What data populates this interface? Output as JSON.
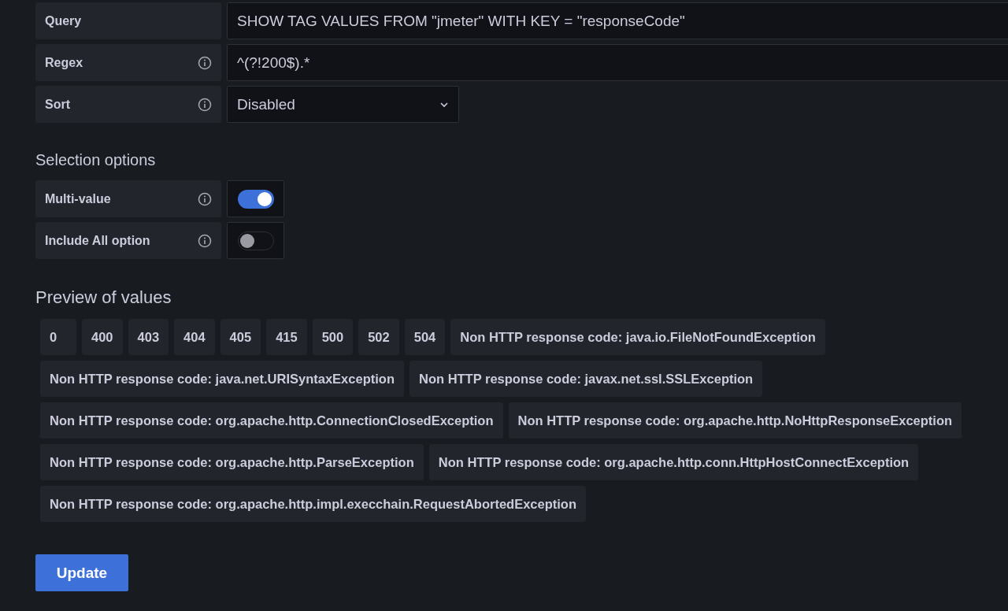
{
  "query_rows": [
    {
      "label": "Query",
      "info": false,
      "kind": "text",
      "value": "SHOW TAG VALUES FROM \"jmeter\" WITH KEY = \"responseCode\""
    },
    {
      "label": "Regex",
      "info": true,
      "kind": "text",
      "value": "^(?!200$).*"
    },
    {
      "label": "Sort",
      "info": true,
      "kind": "select",
      "value": "Disabled"
    }
  ],
  "selection_options": {
    "title": "Selection options",
    "rows": [
      {
        "label": "Multi-value",
        "info": true,
        "on": true
      },
      {
        "label": "Include All option",
        "info": true,
        "on": false
      }
    ]
  },
  "preview": {
    "title": "Preview of values",
    "values": [
      "0",
      "400",
      "403",
      "404",
      "405",
      "415",
      "500",
      "502",
      "504",
      "Non HTTP response code: java.io.FileNotFoundException",
      "Non HTTP response code: java.net.URISyntaxException",
      "Non HTTP response code: javax.net.ssl.SSLException",
      "Non HTTP response code: org.apache.http.ConnectionClosedException",
      "Non HTTP response code: org.apache.http.NoHttpResponseException",
      "Non HTTP response code: org.apache.http.ParseException",
      "Non HTTP response code: org.apache.http.conn.HttpHostConnectException",
      "Non HTTP response code: org.apache.http.impl.execchain.RequestAbortedException"
    ]
  },
  "update_button": "Update"
}
